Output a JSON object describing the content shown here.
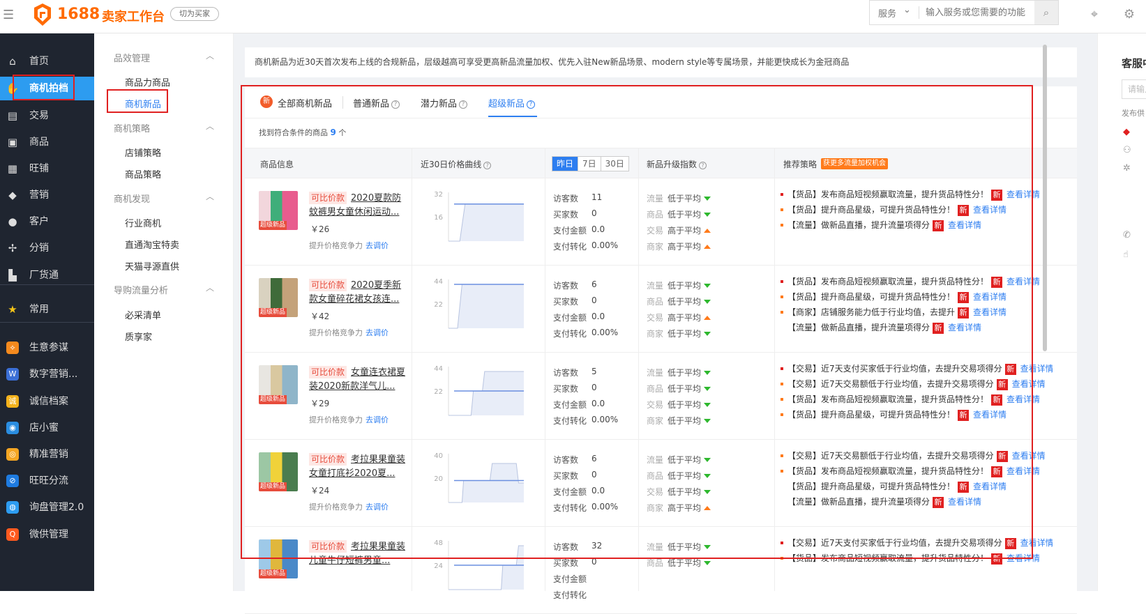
{
  "topbar": {
    "brand": "1688",
    "brand_sub": "卖家工作台",
    "switch_label": "切为买家",
    "search_scope": "服务",
    "search_placeholder": "输入服务或您需要的功能"
  },
  "nav1": [
    {
      "label": "首页",
      "icon": "home-icon",
      "glyph": "⌂"
    },
    {
      "label": "商机拍档",
      "icon": "handshake-icon",
      "glyph": "✋",
      "active": true
    },
    {
      "label": "交易",
      "icon": "receipt-icon",
      "glyph": "▤"
    },
    {
      "label": "商品",
      "icon": "box-icon",
      "glyph": "▣"
    },
    {
      "label": "旺铺",
      "icon": "shop-icon",
      "glyph": "▦"
    },
    {
      "label": "营销",
      "icon": "tag-icon",
      "glyph": "◆"
    },
    {
      "label": "客户",
      "icon": "user-icon",
      "glyph": "●"
    },
    {
      "label": "分销",
      "icon": "distribute-icon",
      "glyph": "✢"
    },
    {
      "label": "厂货通",
      "icon": "factory-icon",
      "glyph": "▙"
    },
    {
      "label": "常用",
      "icon": "star-icon",
      "glyph": "★"
    },
    {
      "label": "生意参谋",
      "icon": "compass-app-icon",
      "glyph": "⟡"
    },
    {
      "label": "数字营销...",
      "icon": "digital-app-icon",
      "glyph": "W"
    },
    {
      "label": "诚信档案",
      "icon": "credit-app-icon",
      "glyph": "诚"
    },
    {
      "label": "店小蜜",
      "icon": "robot-app-icon",
      "glyph": "◉"
    },
    {
      "label": "精准营销",
      "icon": "target-app-icon",
      "glyph": "◎"
    },
    {
      "label": "旺旺分流",
      "icon": "chat-app-icon",
      "glyph": "⊘"
    },
    {
      "label": "询盘管理2.0",
      "icon": "inquiry-app-icon",
      "glyph": "◍"
    },
    {
      "label": "微供管理",
      "icon": "supply-app-icon",
      "glyph": "Q"
    }
  ],
  "nav2": {
    "groups": [
      {
        "title": "品效管理",
        "items": [
          "商品力商品",
          "商机新品"
        ]
      },
      {
        "title": "商机策略",
        "items": [
          "店铺策略",
          "商品策略"
        ]
      },
      {
        "title": "商机发现",
        "items": [
          "行业商机",
          "直通淘宝特卖",
          "天猫寻源直供"
        ]
      },
      {
        "title": "导购流量分析",
        "items": [
          "必采清单",
          "质享家"
        ]
      }
    ]
  },
  "notice": "商机新品为近30天首次发布上线的合规新品，层级越高可享受更高新品流量加权、优先入驻New新品场景、modern style等专属场景，并能更快成长为金冠商品",
  "tabs": {
    "all": "全部商机新品",
    "normal": "普通新品",
    "potential": "潜力新品",
    "super": "超级新品"
  },
  "found": {
    "prefix": "找到符合条件的商品",
    "count": "9",
    "suffix": "个"
  },
  "table": {
    "headers": {
      "info": "商品信息",
      "curve": "近30日价格曲线",
      "index": "新品升级指数",
      "strategy": "推荐策略",
      "strategy_tag": "获更多流量加权机会"
    },
    "ranges": [
      "昨日",
      "7日",
      "30日"
    ],
    "stat_labels": [
      "访客数",
      "买家数",
      "支付金额",
      "支付转化"
    ],
    "idx_labels": [
      "流量",
      "商品",
      "交易",
      "商家"
    ],
    "compare_tag": "可比价款",
    "badge": "超级新品",
    "compete_label": "提升价格竞争力",
    "compete_link": "去调价",
    "new_badge": "新",
    "detail_link": "查看详情"
  },
  "rows": [
    {
      "title": "2020夏款防蚊裤男女童休闲运动...",
      "price": "￥26",
      "y_top": "32",
      "y_mid": "16",
      "stats": [
        "11",
        "0",
        "0.0",
        "0.00%"
      ],
      "idx": [
        [
          "低于平均",
          "down"
        ],
        [
          "低于平均",
          "down"
        ],
        [
          "高于平均",
          "up"
        ],
        [
          "高于平均",
          "up"
        ]
      ],
      "tips": [
        [
          "red",
          "【货品】发布商品短视频赢取流量，提升货品特性分！"
        ],
        [
          "orange",
          "【货品】提升商品星级，可提升货品特性分！"
        ],
        [
          "orange",
          "【流量】做新品直播，提升流量项得分"
        ]
      ],
      "thumb": [
        "#f2d6dc",
        "#3fae7a",
        "#e85c8e"
      ]
    },
    {
      "title": "2020夏季新款女童碎花裙女孩连...",
      "price": "￥42",
      "y_top": "44",
      "y_mid": "22",
      "stats": [
        "6",
        "0",
        "0.0",
        "0.00%"
      ],
      "idx": [
        [
          "低于平均",
          "down"
        ],
        [
          "低于平均",
          "down"
        ],
        [
          "高于平均",
          "up"
        ],
        [
          "低于平均",
          "down"
        ]
      ],
      "tips": [
        [
          "red",
          "【货品】发布商品短视频赢取流量，提升货品特性分！"
        ],
        [
          "orange",
          "【货品】提升商品星级，可提升货品特性分！"
        ],
        [
          "orange",
          "【商家】店铺服务能力低于行业均值，去提升"
        ],
        [
          "none",
          "【流量】做新品直播，提升流量项得分"
        ]
      ],
      "thumb": [
        "#d9d2c0",
        "#3f6b3a",
        "#c4a27a"
      ]
    },
    {
      "title": "女童连衣裙夏装2020新款洋气儿...",
      "price": "￥29",
      "y_top": "44",
      "y_mid": "22",
      "stats": [
        "5",
        "0",
        "0.0",
        "0.00%"
      ],
      "idx": [
        [
          "低于平均",
          "down"
        ],
        [
          "低于平均",
          "down"
        ],
        [
          "低于平均",
          "down"
        ],
        [
          "低于平均",
          "down"
        ]
      ],
      "tips": [
        [
          "red",
          "【交易】近7天支付买家低于行业均值，去提升交易项得分"
        ],
        [
          "orange",
          "【交易】近7天交易额低于行业均值，去提升交易项得分"
        ],
        [
          "orange",
          "【货品】发布商品短视频赢取流量，提升货品特性分！"
        ],
        [
          "orange",
          "【货品】提升商品星级，可提升货品特性分！"
        ]
      ],
      "thumb": [
        "#e8e6e1",
        "#d9c8a0",
        "#8fb5c9"
      ]
    },
    {
      "title": "考拉果果童装女童打底衫2020夏...",
      "price": "￥24",
      "y_top": "40",
      "y_mid": "20",
      "stats": [
        "6",
        "0",
        "0.0",
        "0.00%"
      ],
      "idx": [
        [
          "低于平均",
          "down"
        ],
        [
          "低于平均",
          "down"
        ],
        [
          "低于平均",
          "down"
        ],
        [
          "高于平均",
          "up"
        ]
      ],
      "tips": [
        [
          "orange",
          "【交易】近7天交易额低于行业均值，去提升交易项得分"
        ],
        [
          "orange",
          "【货品】发布商品短视频赢取流量，提升货品特性分！"
        ],
        [
          "none",
          "【货品】提升商品星级，可提升货品特性分！"
        ],
        [
          "none",
          "【流量】做新品直播，提升流量项得分"
        ]
      ],
      "thumb": [
        "#9cc7a4",
        "#f0d23a",
        "#4a7d4f"
      ]
    },
    {
      "title": "考拉果果童装儿童牛仔短裤男童...",
      "price": "",
      "y_top": "48",
      "y_mid": "24",
      "stats": [
        "32",
        "0",
        "",
        ""
      ],
      "idx": [
        [
          "低于平均",
          "down"
        ],
        [
          "低于平均",
          "down"
        ],
        [
          "",
          ""
        ],
        [
          "",
          ""
        ]
      ],
      "tips": [
        [
          "red",
          "【交易】近7天支付买家低于行业均值，去提升交易项得分"
        ],
        [
          "orange",
          "【货品】发布商品短视频赢取流量，提升货品特性分！"
        ]
      ],
      "thumb": [
        "#9ec9e8",
        "#e0b73c",
        "#4a89c8"
      ]
    }
  ],
  "right": {
    "title": "客服中心",
    "input_placeholder": "请输入",
    "sub": "发布供"
  }
}
